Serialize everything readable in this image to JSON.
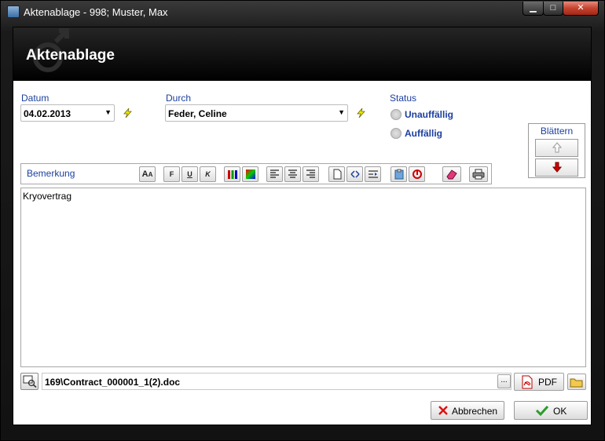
{
  "window": {
    "title": "Aktenablage - 998; Muster, Max",
    "minimize_glyph": "▁",
    "maximize_glyph": "□",
    "close_glyph": "✕"
  },
  "header": {
    "title": "Aktenablage"
  },
  "datum": {
    "label": "Datum",
    "value": "04.02.2013"
  },
  "durch": {
    "label": "Durch",
    "value": "Feder, Celine"
  },
  "status": {
    "label": "Status",
    "options": [
      "Unauffällig",
      "Auffällig"
    ]
  },
  "blaettern": {
    "label": "Blättern"
  },
  "bemerkung": {
    "label": "Bemerkung",
    "text": "Kryovertrag",
    "toolbar": {
      "bold": "F",
      "underline": "U",
      "italic": "K"
    }
  },
  "file": {
    "path": "169\\Contract_000001_1(2).doc",
    "browse_label": "...",
    "pdf_label": "PDF"
  },
  "buttons": {
    "cancel": "Abbrechen",
    "ok": "OK"
  },
  "colors": {
    "label_blue": "#1b3f9e",
    "header_black": "#000000",
    "arrow_red": "#cc0000",
    "ok_green": "#2a9d2a"
  }
}
